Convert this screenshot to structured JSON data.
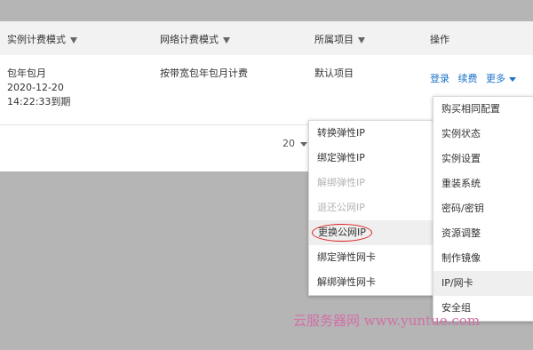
{
  "table": {
    "headers": [
      {
        "label": "实例计费模式",
        "filter": true
      },
      {
        "label": "网络计费模式",
        "filter": true
      },
      {
        "label": "所属项目",
        "filter": true
      },
      {
        "label": "操作",
        "filter": false
      }
    ],
    "row": {
      "billing_mode": "包年包月",
      "expire_date": "2020-12-20",
      "expire_time": "14:22:33到期",
      "network_billing": "按带宽包年包月计费",
      "project": "默认项目",
      "actions": {
        "login": "登录",
        "renew": "续费",
        "more": "更多"
      }
    }
  },
  "pagination": {
    "page_size": "20"
  },
  "submenu": {
    "items": [
      {
        "label": "转换弹性IP",
        "disabled": false
      },
      {
        "label": "绑定弹性IP",
        "disabled": false
      },
      {
        "label": "解绑弹性IP",
        "disabled": true
      },
      {
        "label": "退还公网IP",
        "disabled": true
      },
      {
        "label": "更换公网IP",
        "disabled": false,
        "highlighted": true
      },
      {
        "label": "绑定弹性网卡",
        "disabled": false
      },
      {
        "label": "解绑弹性网卡",
        "disabled": false
      }
    ]
  },
  "more_menu": {
    "items": [
      {
        "label": "购买相同配置"
      },
      {
        "label": "实例状态"
      },
      {
        "label": "实例设置"
      },
      {
        "label": "重装系统"
      },
      {
        "label": "密码/密钥"
      },
      {
        "label": "资源调整"
      },
      {
        "label": "制作镜像"
      },
      {
        "label": "IP/网卡",
        "active": true
      },
      {
        "label": "安全组"
      }
    ]
  },
  "watermark": "云服务器网 www.yuntue.com",
  "colors": {
    "link": "#1a73c8",
    "highlight_circle": "#dd2222",
    "watermark": "#d26fa8",
    "overlay": "#b5b5b5"
  }
}
